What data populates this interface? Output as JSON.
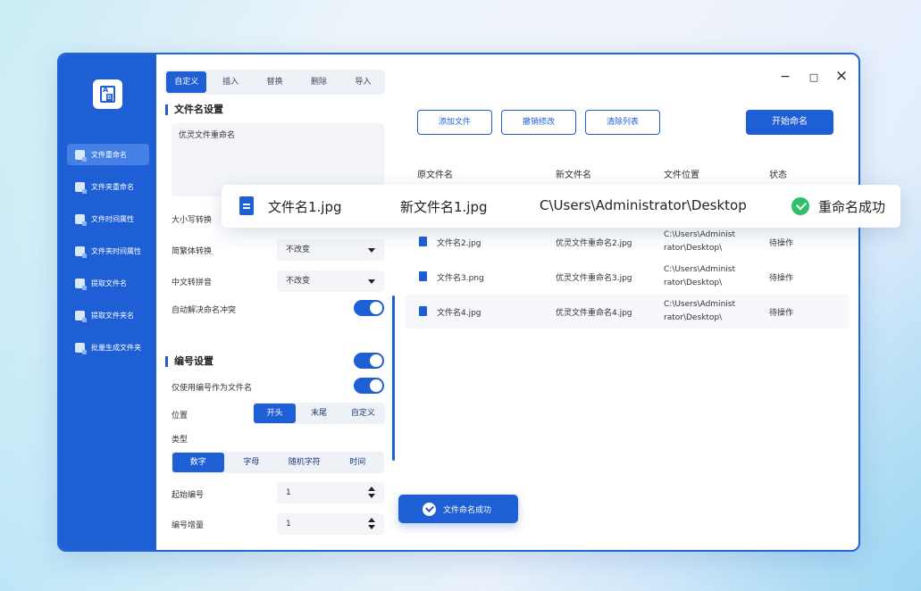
{
  "sidebar": {
    "items": [
      {
        "label": "文件重命名",
        "icon": "file-rename-icon"
      },
      {
        "label": "文件夹重命名",
        "icon": "folder-rename-icon"
      },
      {
        "label": "文件时间属性",
        "icon": "file-time-icon"
      },
      {
        "label": "文件夹时间属性",
        "icon": "folder-time-icon"
      },
      {
        "label": "提取文件名",
        "icon": "extract-filename-icon"
      },
      {
        "label": "提取文件夹名",
        "icon": "extract-foldername-icon"
      },
      {
        "label": "批量生成文件夹",
        "icon": "batch-folder-icon"
      }
    ]
  },
  "panel": {
    "tabs": [
      "自定义",
      "插入",
      "替换",
      "删除",
      "导入"
    ],
    "filename_title": "文件名设置",
    "filename_value": "优灵文件重命名",
    "case_label": "大小写转换",
    "trad_label": "简繁体转换",
    "trad_value": "不改变",
    "pinyin_label": "中文转拼音",
    "pinyin_value": "不改变",
    "conflict_label": "自动解决命名冲突",
    "number_title": "编号设置",
    "only_number_label": "仅使用编号作为文件名",
    "position_label": "位置",
    "position_options": [
      "开头",
      "末尾",
      "自定义"
    ],
    "type_label": "类型",
    "type_options": [
      "数字",
      "字母",
      "随机字符",
      "时间"
    ],
    "start_label": "起始编号",
    "start_value": "1",
    "increment_label": "编号增量",
    "increment_value": "1"
  },
  "main": {
    "window_controls": {
      "minimize": "−",
      "maximize": "□",
      "close": "×"
    },
    "buttons": {
      "add": "添加文件",
      "undo": "撤销修改",
      "clear": "清除列表",
      "start": "开始命名"
    },
    "headers": [
      "原文件名",
      "新文件名",
      "文件位置",
      "状态"
    ],
    "rows": [
      {
        "orig": "文件名2.jpg",
        "new": "优灵文件重命名2.jpg",
        "loc1": "C:\\Users\\Administ",
        "loc2": "rator\\Desktop\\",
        "status": "待操作"
      },
      {
        "orig": "文件名3.png",
        "new": "优灵文件重命名3.jpg",
        "loc1": "C:\\Users\\Administ",
        "loc2": "rator\\Desktop\\",
        "status": "待操作"
      },
      {
        "orig": "文件名4.jpg",
        "new": "优灵文件重命名4.jpg",
        "loc1": "C:\\Users\\Administ",
        "loc2": "rator\\Desktop\\",
        "status": "待操作"
      }
    ],
    "toast": "文件命名成功"
  },
  "highlight": {
    "orig": "文件名1.jpg",
    "new": "新文件名1.jpg",
    "location": "C\\Users\\Administrator\\Desktop",
    "status": "重命名成功"
  },
  "colors": {
    "accent": "#1e5fd6",
    "success": "#2ec06a"
  }
}
